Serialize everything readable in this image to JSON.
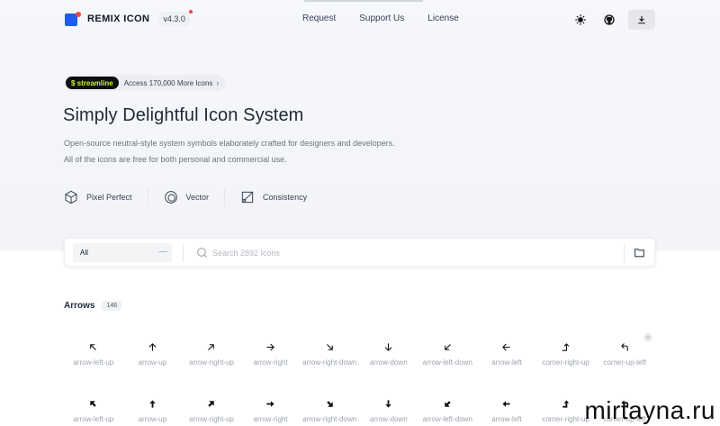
{
  "header": {
    "logo_text": "REMIX ICON",
    "version": "v4.3.0",
    "nav": [
      "Request",
      "Support Us",
      "License"
    ],
    "icons": [
      "sun-icon",
      "github-icon",
      "download-icon"
    ]
  },
  "hero": {
    "badge_brand": "$ streamline",
    "badge_text": "Access 170,000 More Icons",
    "title": "Simply Delightful Icon System",
    "desc_line1": "Open-source neutral-style system symbols elaborately crafted for designers and developers.",
    "desc_line2": "All of the icons are free for both personal and commercial use.",
    "features": [
      {
        "label": "Pixel Perfect",
        "icon": "cube-icon"
      },
      {
        "label": "Vector",
        "icon": "vector-circle-icon"
      },
      {
        "label": "Consistency",
        "icon": "square-diagonal-icon"
      }
    ]
  },
  "search": {
    "category": "All",
    "placeholder": "Search 2892 Icons"
  },
  "section": {
    "title": "Arrows",
    "count": "146"
  },
  "icons_row1": [
    "arrow-left-up",
    "arrow-up",
    "arrow-right-up",
    "arrow-right",
    "arrow-right-down",
    "arrow-down",
    "arrow-left-down",
    "arrow-left",
    "corner-right-up",
    "corner-up-left"
  ],
  "icons_row2": [
    "arrow-left-up",
    "arrow-up",
    "arrow-right-up",
    "arrow-right",
    "arrow-right-down",
    "arrow-down",
    "arrow-left-down",
    "arrow-left",
    "corner-right-up",
    "corner-up-left"
  ],
  "watermark": "mirtayna.ru",
  "colors": {
    "brand_blue": "#1f5cf1",
    "brand_red": "#ef4444",
    "streamline_green": "#c6f432"
  }
}
